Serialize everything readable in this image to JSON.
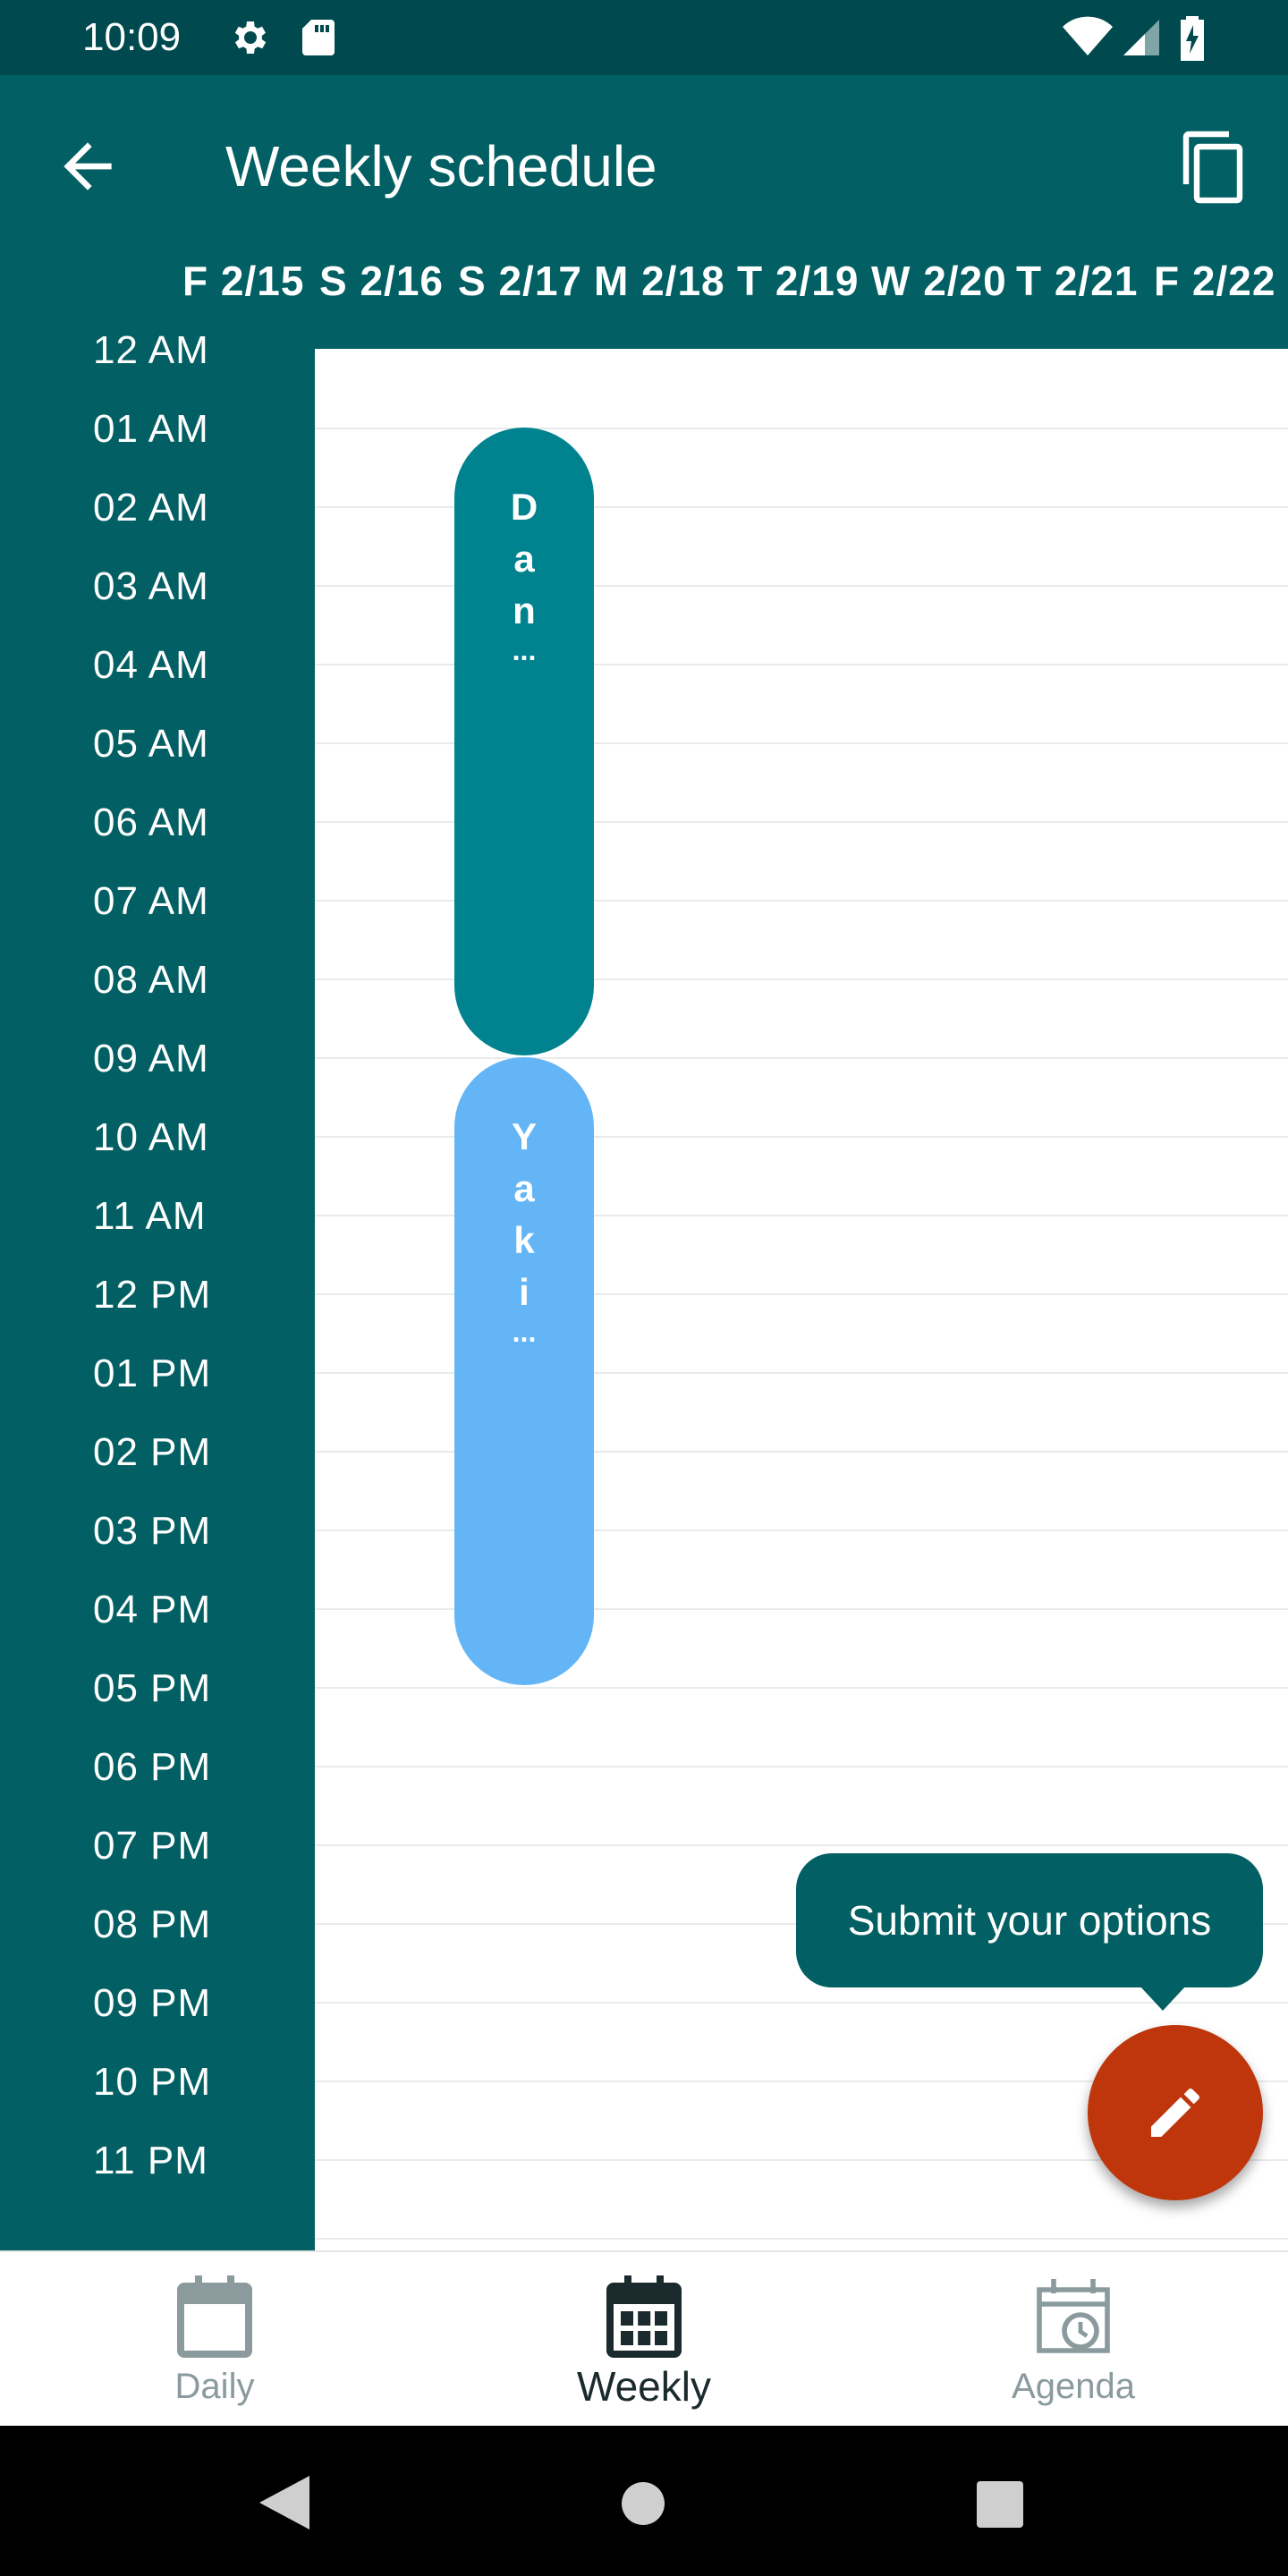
{
  "status_bar": {
    "time": "10:09",
    "left_icons": [
      "gear-icon",
      "sd-card-icon"
    ],
    "right_icons": [
      "wifi-icon",
      "signal-icon",
      "battery-charging-icon"
    ]
  },
  "app_bar": {
    "title": "Weekly schedule",
    "back_icon": "arrow-left-icon",
    "action_icon": "copy-icon",
    "background": "#025f63"
  },
  "days": [
    "F 2/15",
    "S 2/16",
    "S 2/17",
    "M 2/18",
    "T 2/19",
    "W 2/20",
    "T 2/21",
    "F 2/22"
  ],
  "hours": [
    "12 AM",
    "01 AM",
    "02 AM",
    "03 AM",
    "04 AM",
    "05 AM",
    "06 AM",
    "07 AM",
    "08 AM",
    "09 AM",
    "10 AM",
    "11 AM",
    "12 PM",
    "01 PM",
    "02 PM",
    "03 PM",
    "04 PM",
    "05 PM",
    "06 PM",
    "07 PM",
    "08 PM",
    "09 PM",
    "10 PM",
    "11 PM"
  ],
  "events": [
    {
      "letters": [
        "D",
        "a",
        "n"
      ],
      "ellipsis": "...",
      "color": "#00838f"
    },
    {
      "letters": [
        "Y",
        "a",
        "k",
        "i"
      ],
      "ellipsis": "...",
      "color": "#64b5f6"
    }
  ],
  "tooltip": {
    "text": "Submit your options"
  },
  "fab": {
    "icon": "pencil-icon",
    "color": "#bf360c"
  },
  "bottom_nav": {
    "items": [
      {
        "label": "Daily",
        "icon": "calendar-blank-icon",
        "active": false
      },
      {
        "label": "Weekly",
        "icon": "calendar-grid-icon",
        "active": true
      },
      {
        "label": "Agenda",
        "icon": "calendar-clock-icon",
        "active": false
      }
    ]
  },
  "system_nav": {
    "icons": [
      "back-triangle-icon",
      "home-circle-icon",
      "recents-square-icon"
    ]
  }
}
